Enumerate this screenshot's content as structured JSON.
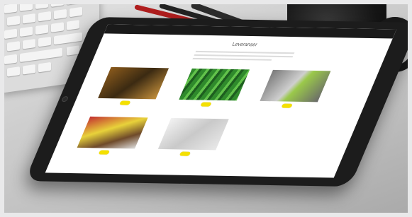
{
  "website": {
    "logo_text": "",
    "nav_items": [
      "",
      "",
      "",
      "",
      "",
      "",
      ""
    ],
    "page_heading": "Leveranser",
    "cards": [
      {
        "caption": "",
        "image": "warehouse-photo"
      },
      {
        "caption": "",
        "image": "greenhouse-photo"
      },
      {
        "caption": "",
        "image": "workers-in-hivis-photo"
      },
      {
        "caption": "",
        "image": "workers-in-hivis-photo"
      },
      {
        "caption": "",
        "image": "site-plan-photo"
      }
    ]
  },
  "colors": {
    "accent_yellow": "#f4e000",
    "tablet_bezel": "#1c1c1c",
    "mug": "#151515",
    "desk": "#bdbdbd"
  }
}
